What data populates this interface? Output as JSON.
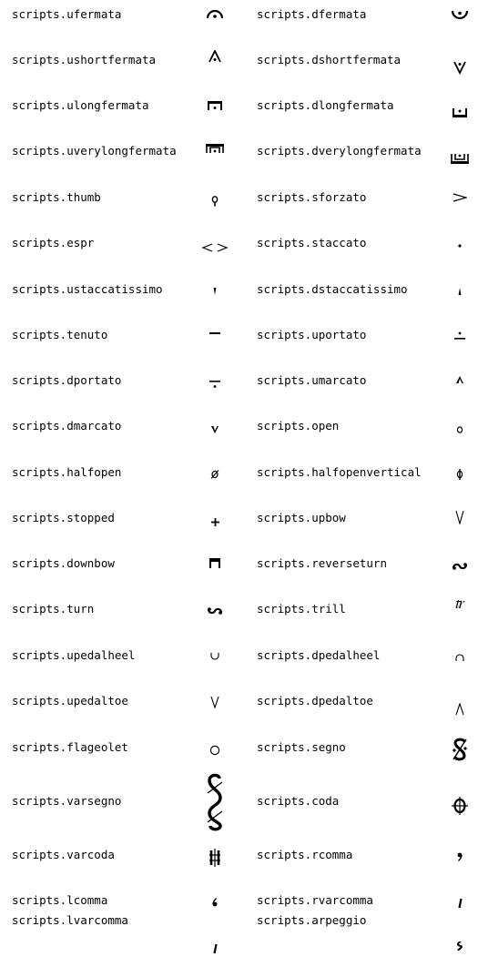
{
  "rows": [
    {
      "left": {
        "name": "scripts.ufermata",
        "icon": "ufermata-icon"
      },
      "right": {
        "name": "scripts.dfermata",
        "icon": "dfermata-icon"
      }
    },
    {
      "left": {
        "name": "scripts.ushortfermata",
        "icon": "ushortfermata-icon"
      },
      "right": {
        "name": "scripts.dshortfermata",
        "icon": "dshortfermata-icon"
      }
    },
    {
      "left": {
        "name": "scripts.ulongfermata",
        "icon": "ulongfermata-icon"
      },
      "right": {
        "name": "scripts.dlongfermata",
        "icon": "dlongfermata-icon"
      }
    },
    {
      "left": {
        "name": "scripts.uverylongfermata",
        "icon": "uverylongfermata-icon"
      },
      "right": {
        "name": "scripts.dverylongfermata",
        "icon": "dverylongfermata-icon"
      }
    },
    {
      "left": {
        "name": "scripts.thumb",
        "icon": "thumb-icon"
      },
      "right": {
        "name": "scripts.sforzato",
        "icon": "sforzato-icon"
      }
    },
    {
      "left": {
        "name": "scripts.espr",
        "icon": "espr-icon"
      },
      "right": {
        "name": "scripts.staccato",
        "icon": "staccato-icon"
      }
    },
    {
      "left": {
        "name": "scripts.ustaccatissimo",
        "icon": "ustaccatissimo-icon"
      },
      "right": {
        "name": "scripts.dstaccatissimo",
        "icon": "dstaccatissimo-icon"
      }
    },
    {
      "left": {
        "name": "scripts.tenuto",
        "icon": "tenuto-icon"
      },
      "right": {
        "name": "scripts.uportato",
        "icon": "uportato-icon"
      }
    },
    {
      "left": {
        "name": "scripts.dportato",
        "icon": "dportato-icon"
      },
      "right": {
        "name": "scripts.umarcato",
        "icon": "umarcato-icon"
      }
    },
    {
      "left": {
        "name": "scripts.dmarcato",
        "icon": "dmarcato-icon"
      },
      "right": {
        "name": "scripts.open",
        "icon": "open-icon"
      }
    },
    {
      "left": {
        "name": "scripts.halfopen",
        "icon": "halfopen-icon"
      },
      "right": {
        "name": "scripts.halfopenvertical",
        "icon": "halfopenvertical-icon"
      }
    },
    {
      "left": {
        "name": "scripts.stopped",
        "icon": "stopped-icon"
      },
      "right": {
        "name": "scripts.upbow",
        "icon": "upbow-icon"
      }
    },
    {
      "left": {
        "name": "scripts.downbow",
        "icon": "downbow-icon"
      },
      "right": {
        "name": "scripts.reverseturn",
        "icon": "reverseturn-icon"
      }
    },
    {
      "left": {
        "name": "scripts.turn",
        "icon": "turn-icon"
      },
      "right": {
        "name": "scripts.trill",
        "icon": "trill-icon"
      }
    },
    {
      "left": {
        "name": "scripts.upedalheel",
        "icon": "upedalheel-icon"
      },
      "right": {
        "name": "scripts.dpedalheel",
        "icon": "dpedalheel-icon"
      }
    },
    {
      "left": {
        "name": "scripts.upedaltoe",
        "icon": "upedaltoe-icon"
      },
      "right": {
        "name": "scripts.dpedaltoe",
        "icon": "dpedaltoe-icon"
      }
    },
    {
      "left": {
        "name": "scripts.flageolet",
        "icon": "flageolet-icon"
      },
      "right": {
        "name": "scripts.segno",
        "icon": "segno-icon"
      }
    },
    {
      "left": {
        "name": "scripts.varsegno",
        "icon": "varsegno-icon"
      },
      "right": {
        "name": "scripts.coda",
        "icon": "coda-icon"
      }
    },
    {
      "left": {
        "name": "scripts.varcoda",
        "icon": "varcoda-icon"
      },
      "right": {
        "name": "scripts.rcomma",
        "icon": "rcomma-icon"
      }
    },
    {
      "left": {
        "name": "scripts.lcomma",
        "icon": "lcomma-icon"
      },
      "right": {
        "name": "scripts.rvarcomma",
        "icon": "rvarcomma-icon"
      }
    },
    {
      "left": {
        "name": "scripts.lvarcomma",
        "icon": "lvarcomma-icon"
      },
      "right": {
        "name": "scripts.arpeggio",
        "icon": "arpeggio-icon"
      }
    }
  ]
}
